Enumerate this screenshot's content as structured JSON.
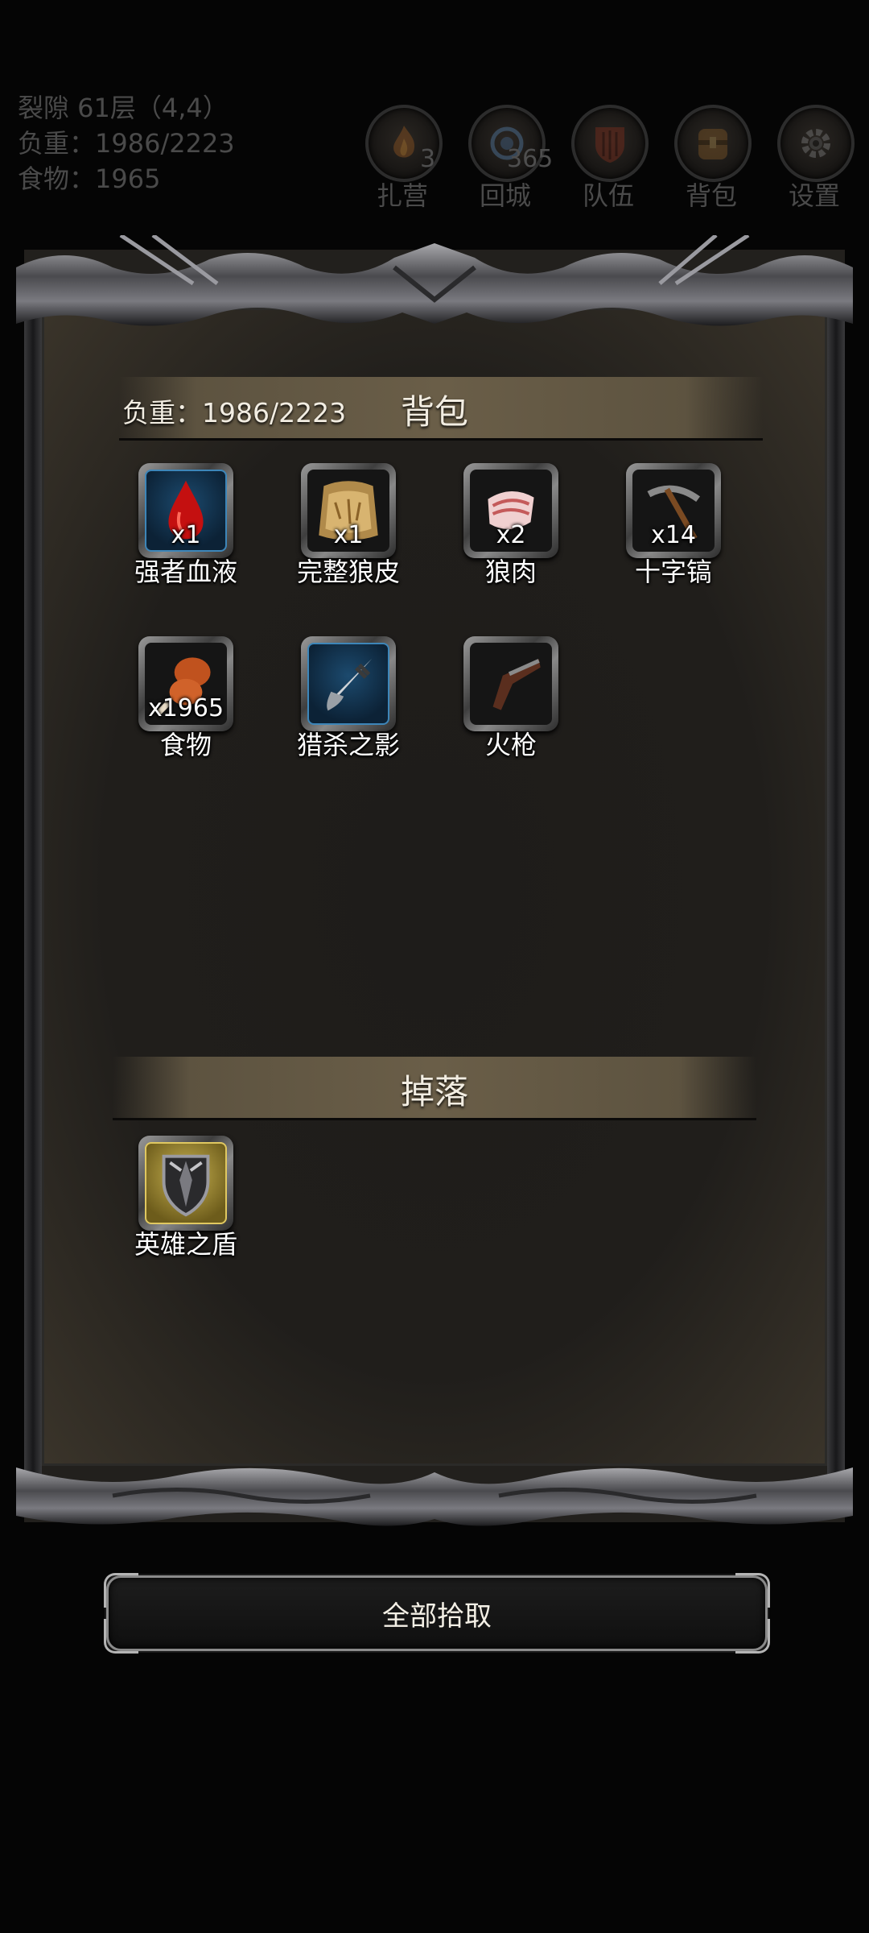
{
  "hud": {
    "location": "裂隙 61层（4,4）",
    "weight": "负重：1986/2223",
    "food": "食物：1965",
    "buttons": [
      {
        "label": "扎营",
        "count": "3",
        "icon": "campfire-icon"
      },
      {
        "label": "回城",
        "count": "365",
        "icon": "portal-icon"
      },
      {
        "label": "队伍",
        "count": "",
        "icon": "shield-team-icon"
      },
      {
        "label": "背包",
        "count": "",
        "icon": "backpack-icon"
      },
      {
        "label": "设置",
        "count": "",
        "icon": "gear-icon"
      }
    ]
  },
  "backpack": {
    "title": "背包",
    "weight": "负重：1986/2223",
    "items": [
      {
        "name": "强者血液",
        "qty": "x1",
        "icon": "blood-drop-icon",
        "frame": "blue"
      },
      {
        "name": "完整狼皮",
        "qty": "x1",
        "icon": "wolf-pelt-icon",
        "frame": "plain"
      },
      {
        "name": "狼肉",
        "qty": "x2",
        "icon": "meat-icon",
        "frame": "plain"
      },
      {
        "name": "十字镐",
        "qty": "x14",
        "icon": "pickaxe-icon",
        "frame": "plain"
      },
      {
        "name": "食物",
        "qty": "x1965",
        "icon": "drumstick-icon",
        "frame": "plain"
      },
      {
        "name": "猎杀之影",
        "qty": "",
        "icon": "dagger-icon",
        "frame": "blue"
      },
      {
        "name": "火枪",
        "qty": "",
        "icon": "musket-icon",
        "frame": "plain"
      }
    ]
  },
  "drops": {
    "title": "掉落",
    "items": [
      {
        "name": "英雄之盾",
        "qty": "",
        "icon": "hero-shield-icon",
        "frame": "gold"
      }
    ]
  },
  "pickup_all": "全部拾取"
}
